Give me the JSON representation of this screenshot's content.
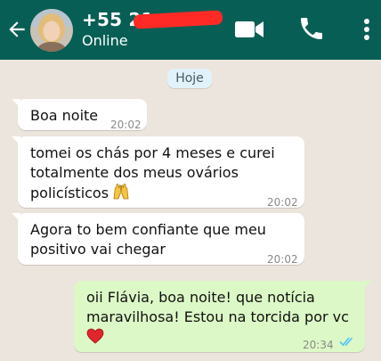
{
  "header": {
    "contact_name": "+55 21",
    "status": "Online"
  },
  "icons": {
    "back": "arrow-left-icon",
    "video": "video-camera-icon",
    "call": "phone-icon",
    "menu": "more-vertical-icon"
  },
  "colors": {
    "header_bg": "#075e54",
    "chat_bg": "#ece5dd",
    "incoming_bubble": "#ffffff",
    "outgoing_bubble": "#dcf8c6",
    "read_ticks": "#4fc3f7"
  },
  "date_chip": "Hoje",
  "messages": [
    {
      "lines": [
        "Boa noite"
      ],
      "time": "20:02"
    },
    {
      "lines": [
        "tomei os chás por 4 meses e curei",
        "totalmente dos meus ovários",
        "policísticos"
      ],
      "time": "20:02"
    },
    {
      "lines": [
        "Agora to bem confiante que meu",
        "positivo vai chegar"
      ],
      "time": "20:02"
    },
    {
      "lines": [
        "oii Flávia, boa noite! que notícia",
        "maravilhosa! Estou na torcida por vc"
      ],
      "time": "20:34"
    }
  ]
}
